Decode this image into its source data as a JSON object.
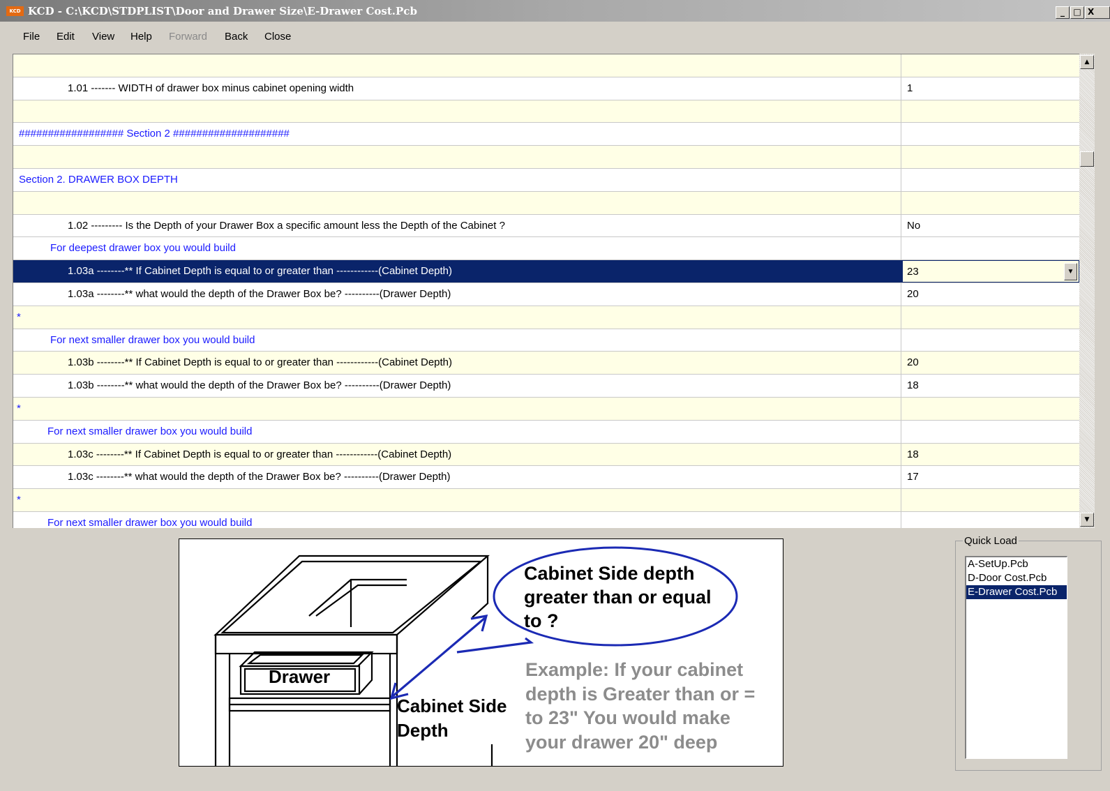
{
  "window": {
    "app_icon": "KCD",
    "title": "KCD  -  C:\\KCD\\STDPLIST\\Door and Drawer Size\\E-Drawer Cost.Pcb",
    "controls": [
      "_",
      "□",
      "X"
    ]
  },
  "menu": [
    "File",
    "Edit",
    "View",
    "Help",
    "Forward",
    "Back",
    "Close"
  ],
  "grid": {
    "rows": [
      {
        "label": "",
        "value": "",
        "bg": "yellow",
        "style": "plain"
      },
      {
        "label": "1.01 -------  WIDTH of drawer box minus cabinet opening width",
        "value": "1",
        "bg": "white",
        "style": "ind1"
      },
      {
        "label": "",
        "value": "",
        "bg": "yellow",
        "style": "plain"
      },
      {
        "label": "##################  Section 2  ####################",
        "value": "",
        "bg": "white",
        "style": "blue0"
      },
      {
        "label": "",
        "value": "",
        "bg": "yellow",
        "style": "plain"
      },
      {
        "label": "Section 2.  DRAWER BOX DEPTH",
        "value": "",
        "bg": "white",
        "style": "blue0"
      },
      {
        "label": "",
        "value": "",
        "bg": "yellow",
        "style": "plain"
      },
      {
        "label": "1.02 --------- Is the Depth of your Drawer Box a specific amount less the Depth of the Cabinet ?",
        "value": "No",
        "bg": "white",
        "style": "ind1"
      },
      {
        "label": "For deepest drawer box you would build",
        "value": "",
        "bg": "white",
        "style": "bluesub"
      },
      {
        "label": "1.03a --------** If Cabinet Depth is equal to or greater than ------------(Cabinet Depth)",
        "value": "23",
        "bg": "selected",
        "style": "ind1"
      },
      {
        "label": "1.03a --------** what would the depth of the Drawer Box be? ----------(Drawer Depth)",
        "value": "20",
        "bg": "white",
        "style": "ind1"
      },
      {
        "label": "*",
        "value": "",
        "bg": "yellow",
        "style": "star"
      },
      {
        "label": "For next smaller drawer box you would build",
        "value": "",
        "bg": "white",
        "style": "bluesub"
      },
      {
        "label": "1.03b --------** If Cabinet Depth is equal to or greater than ------------(Cabinet Depth)",
        "value": "20",
        "bg": "yellow",
        "style": "ind1"
      },
      {
        "label": "1.03b --------** what would the depth of the Drawer Box be? ----------(Drawer Depth)",
        "value": "18",
        "bg": "white",
        "style": "ind1"
      },
      {
        "label": "*",
        "value": "",
        "bg": "yellow",
        "style": "star"
      },
      {
        "label": "For next smaller drawer box you would build",
        "value": "",
        "bg": "white",
        "style": "bluesub2"
      },
      {
        "label": "1.03c --------** If Cabinet Depth is equal to or greater than ------------(Cabinet Depth)",
        "value": "18",
        "bg": "yellow",
        "style": "ind1"
      },
      {
        "label": "1.03c --------** what would the depth of the Drawer Box be? ----------(Drawer Depth)",
        "value": "17",
        "bg": "white",
        "style": "ind1"
      },
      {
        "label": "*",
        "value": "",
        "bg": "yellow",
        "style": "star"
      },
      {
        "label": "For next smaller drawer box you would build",
        "value": "",
        "bg": "white",
        "style": "bluesub2"
      }
    ],
    "scroll_up": "▲",
    "scroll_down": "▼",
    "combo_arrow": "▼"
  },
  "illustration": {
    "drawer_label": "Drawer",
    "callout_top": "Cabinet Side depth\ngreater than or equal\nto ?",
    "callout_example": "Example: If your cabinet\ndepth is Greater than or =\nto 23\" You would make\nyour drawer 20\" deep",
    "callout_side": "Cabinet Side\nDepth",
    "colors": {
      "ellipse": "#1b2ab4",
      "arrow": "#1b2ab4",
      "example_text": "#8c8c8c"
    }
  },
  "quick_load": {
    "legend": "Quick Load",
    "items": [
      "A-SetUp.Pcb",
      "D-Door Cost.Pcb",
      "E-Drawer Cost.Pcb"
    ],
    "selected": "E-Drawer Cost.Pcb"
  },
  "colors": {
    "selection": "#0a246a",
    "row_yellow": "#ffffe6",
    "section_blue": "#1a1aff",
    "chrome": "#d4d0c8"
  }
}
